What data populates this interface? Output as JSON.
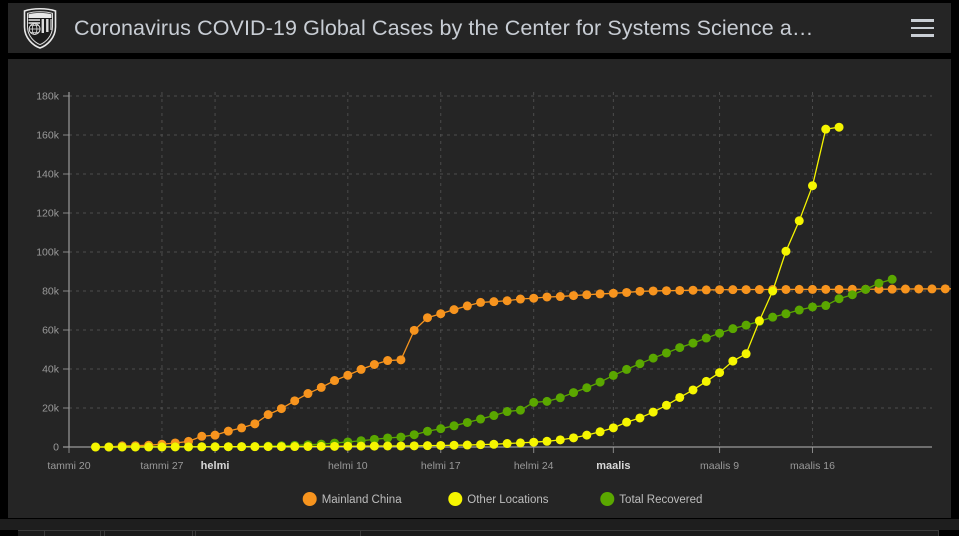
{
  "window": {
    "background": "#000000",
    "panel_bg": "#252525"
  },
  "header": {
    "title": "Coronavirus COVID-19 Global Cases by the Center for Systems Science a…",
    "logo_name": "johns-hopkins-shield-logo",
    "menu_label": "menu"
  },
  "chart_data": {
    "type": "line",
    "title": "",
    "subtitle": "",
    "xlabel": "",
    "ylabel": "",
    "grid": true,
    "legend_position": "bottom",
    "ylim": [
      0,
      180000
    ],
    "ytick_labels": [
      "0",
      "20k",
      "40k",
      "60k",
      "80k",
      "100k",
      "120k",
      "140k",
      "160k",
      "180k"
    ],
    "ytick_values": [
      0,
      20000,
      40000,
      60000,
      80000,
      100000,
      120000,
      140000,
      160000,
      180000
    ],
    "xtick_labels": [
      "tammi 20",
      "tammi 27",
      "helmi",
      "helmi 10",
      "helmi 17",
      "helmi 24",
      "maalis",
      "maalis 9",
      "maalis 16"
    ],
    "xtick_bold": [
      false,
      false,
      true,
      false,
      false,
      false,
      true,
      false,
      false
    ],
    "xtick_indices": [
      0,
      7,
      11,
      21,
      28,
      35,
      41,
      49,
      56
    ],
    "x_start_index": 2,
    "n_points": 61,
    "series": [
      {
        "name": "Mainland China",
        "color": "#f7941e",
        "values": [
          0,
          0,
          547,
          639,
          916,
          1399,
          2062,
          2863,
          5494,
          6070,
          8124,
          9783,
          11871,
          16607,
          19693,
          23680,
          27409,
          30553,
          34075,
          36778,
          39790,
          42306,
          44327,
          44699,
          59832,
          66292,
          68347,
          70446,
          72364,
          74139,
          74546,
          75000,
          75891,
          76288,
          76936,
          77150,
          77658,
          78064,
          78497,
          78824,
          79251,
          79824,
          80026,
          80151,
          80270,
          80409,
          80552,
          80651,
          80695,
          80735,
          80754,
          80778,
          80793,
          80813,
          80824,
          80844,
          80860,
          80881,
          80894,
          80928,
          80945,
          81008,
          81054,
          81077,
          81116,
          81151
        ]
      },
      {
        "name": "Other Locations",
        "color": "#f5f500",
        "values": [
          6,
          8,
          14,
          25,
          41,
          57,
          64,
          87,
          111,
          128,
          153,
          173,
          183,
          188,
          212,
          227,
          265,
          317,
          343,
          361,
          457,
          476,
          523,
          538,
          595,
          685,
          780,
          896,
          999,
          1200,
          1402,
          1769,
          2105,
          2459,
          2918,
          3664,
          4691,
          6088,
          7800,
          9826,
          12733,
          14901,
          17914,
          21400,
          25404,
          29256,
          33627,
          38170,
          44067,
          47804,
          64727,
          80000,
          100390,
          116000,
          134000,
          163000,
          164000
        ]
      },
      {
        "name": "Total Recovered",
        "color": "#5aa700",
        "values": [
          0,
          0,
          28,
          30,
          36,
          39,
          49,
          58,
          101,
          120,
          135,
          214,
          275,
          463,
          614,
          843,
          1115,
          1477,
          1999,
          2596,
          3219,
          3918,
          4636,
          5082,
          6295,
          8058,
          9395,
          10865,
          12583,
          14352,
          16121,
          18177,
          18890,
          22886,
          23394,
          25227,
          27905,
          30384,
          33277,
          36711,
          39782,
          42716,
          45602,
          48228,
          50983,
          53288,
          55866,
          58358,
          60694,
          62494,
          64404,
          66580,
          68324,
          70251,
          71820,
          72552,
          76034,
          78088,
          80840,
          84000,
          86000
        ]
      }
    ],
    "legend": [
      {
        "label": "Mainland China",
        "color": "#f7941e"
      },
      {
        "label": "Other Locations",
        "color": "#f5f500"
      },
      {
        "label": "Total Recovered",
        "color": "#5aa700"
      }
    ]
  },
  "taskbar": {
    "visible": true
  }
}
